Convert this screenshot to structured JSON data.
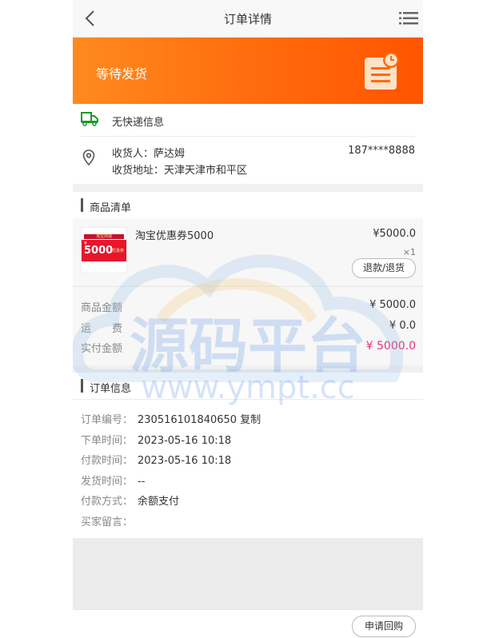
{
  "header": {
    "title": "订单详情",
    "back_icon": "chevron-left-icon",
    "menu_icon": "list-icon"
  },
  "banner": {
    "status": "等待发货",
    "icon": "clipboard-clock-icon",
    "gradient": [
      "#ff8a1f",
      "#ff5500"
    ]
  },
  "delivery": {
    "text": "无快递信息",
    "icon": "truck-icon",
    "icon_color": "#1a9b2a"
  },
  "address": {
    "receiver": "收货人：萨达姆",
    "phone": "187****8888",
    "address": "收货地址：天津天津市和平区",
    "icon": "location-pin-icon"
  },
  "goods": {
    "section_title": "商品清单",
    "items": [
      {
        "name": "淘宝优惠券5000",
        "price": "¥5000.0",
        "qty": "×1",
        "refund_label": "退款/退货",
        "thumb": {
          "top_text": "淘宝商城",
          "amount": "5000",
          "currency": "¥",
          "tag": "优惠券"
        }
      }
    ]
  },
  "amounts": {
    "rows": [
      {
        "label": "商品金额",
        "value": "¥ 5000.0"
      },
      {
        "label": "运　　费",
        "value": "¥ 0.0"
      },
      {
        "label": "实付金额",
        "value": "¥ 5000.0"
      }
    ],
    "highlight_color": "#e4357b"
  },
  "order_info": {
    "section_title": "订单信息",
    "rows": [
      {
        "label": "订单编号：",
        "value": "230516101840650",
        "action": "复制"
      },
      {
        "label": "下单时间：",
        "value": "2023-05-16 10:18"
      },
      {
        "label": "付款时间：",
        "value": "2023-05-16 10:18"
      },
      {
        "label": "发货时间：",
        "value": "--"
      },
      {
        "label": "付款方式：",
        "value": "余额支付"
      },
      {
        "label": "买家留言：",
        "value": ""
      }
    ]
  },
  "footer": {
    "button": "申请回购"
  },
  "watermark": {
    "title": "源码平台",
    "url": "www.ympt.cc"
  }
}
